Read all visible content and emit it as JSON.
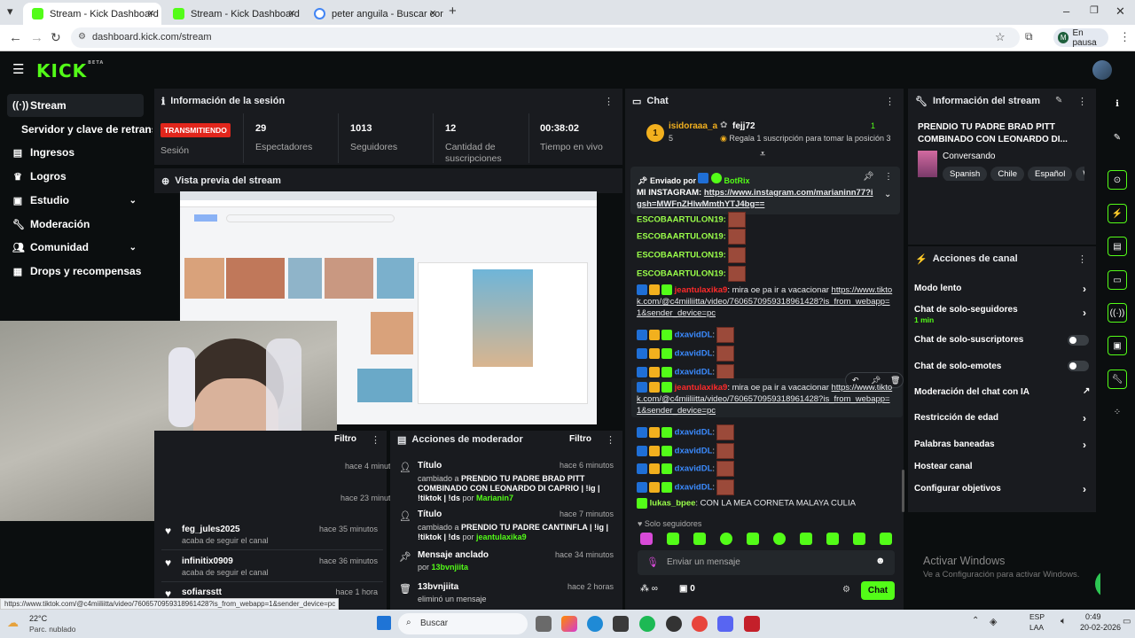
{
  "browser": {
    "tabs": [
      {
        "title": "Stream - Kick Dashboard",
        "fav": "#53fc18"
      },
      {
        "title": "Stream - Kick Dashboard",
        "fav": "#53fc18"
      },
      {
        "title": "peter anguila - Buscar con Goo",
        "fav": "#4285f4"
      }
    ],
    "url": "dashboard.kick.com/stream",
    "profile_initial": "M",
    "profile_status": "En pausa"
  },
  "kick": {
    "logo": "KICK",
    "beta": "BETA"
  },
  "sidebar": {
    "items": [
      {
        "label": "Stream",
        "icon": "((·))"
      },
      {
        "label": "Servidor y clave de retransmisión",
        "icon": ""
      },
      {
        "label": "Ingresos",
        "icon": "▤"
      },
      {
        "label": "Logros",
        "icon": "🏆"
      },
      {
        "label": "Estudio",
        "icon": "▣"
      },
      {
        "label": "Moderación",
        "icon": "🔧"
      },
      {
        "label": "Comunidad",
        "icon": "👥"
      },
      {
        "label": "Drops y recompensas",
        "icon": "🎁"
      }
    ]
  },
  "session": {
    "title": "Información de la sesión",
    "live_badge": "TRANSMITIENDO",
    "live_label": "Sesión",
    "stats": [
      {
        "value": "29",
        "label": "Espectadores"
      },
      {
        "value": "1013",
        "label": "Seguidores"
      },
      {
        "value": "12",
        "label": "Cantidad de suscripciones"
      },
      {
        "value": "00:38:02",
        "label": "Tiempo en vivo"
      }
    ]
  },
  "preview": {
    "title": "Vista previa del stream"
  },
  "chat": {
    "title": "Chat",
    "leaders": [
      {
        "name": "isidoraaa_a",
        "rank": "1",
        "count": "5"
      },
      {
        "name": "fejj72",
        "gift": "1",
        "text": "Regala 1 suscripción para tomar la posición 3"
      }
    ],
    "pinned": {
      "by_label": "Enviado por",
      "by": "BotRix",
      "text": "MI INSTAGRAM:",
      "link": "https://www.instagram.com/marianinn77?igsh=MWFnZHlwMmthYTJ4bg=="
    },
    "messages": [
      {
        "user": "ESCOBAARTULON19:",
        "color": "#9aff4a",
        "text": ""
      },
      {
        "user": "ESCOBAARTULON19:",
        "color": "#9aff4a",
        "text": ""
      },
      {
        "user": "ESCOBAARTULON19:",
        "color": "#9aff4a",
        "text": ""
      },
      {
        "user": "ESCOBAARTULON19:",
        "color": "#9aff4a",
        "text": ""
      },
      {
        "user": "jeantulaxika9",
        "color": "#ff2a2a",
        "text": ": mira oe pa ir a vacacionar",
        "link": "https://www.tiktok.com/@c4miiliitta/video/7606570959318961428?is_from_webapp=1&sender_device=pc"
      },
      {
        "user": "dxavidDL",
        "color": "#3b8bff",
        "text": ":"
      },
      {
        "user": "dxavidDL",
        "color": "#3b8bff",
        "text": ":"
      },
      {
        "user": "dxavidDL",
        "color": "#3b8bff",
        "text": ":"
      },
      {
        "user": "jeantulaxika9",
        "color": "#ff2a2a",
        "text": ": mira oe pa ir a vacacionar",
        "link": "https://www.tiktok.com/@c4miiliitta/video/7606570959318961428?is_from_webapp=1&sender_device=pc"
      },
      {
        "user": "dxavidDL",
        "color": "#3b8bff",
        "text": ":"
      },
      {
        "user": "dxavidDL",
        "color": "#3b8bff",
        "text": ":"
      },
      {
        "user": "dxavidDL",
        "color": "#3b8bff",
        "text": ":"
      },
      {
        "user": "dxavidDL",
        "color": "#3b8bff",
        "text": ":"
      },
      {
        "user": "lukas_bpee",
        "color": "#9aff4a",
        "text": ": CON LA MEA CORNETA MALAYA CULIA"
      }
    ],
    "mode": "Solo seguidores",
    "input_placeholder": "Enviar un mensaje",
    "points": "∞",
    "gifts": "0",
    "send": "Chat"
  },
  "stream_info": {
    "title": "Información del stream",
    "stream_title": "PRENDIO TU PADRE BRAD PITT COMBINADO CON LEONARDO DI...",
    "category": "Conversando",
    "tags": [
      "Spanish",
      "Chile",
      "Español",
      "Wa"
    ]
  },
  "channel_actions": {
    "title": "Acciones de canal",
    "items": [
      {
        "label": "Modo lento"
      },
      {
        "label": "Chat de solo-seguidores",
        "sub": "1 min"
      },
      {
        "label": "Chat de solo-suscriptores"
      },
      {
        "label": "Chat de solo-emotes"
      },
      {
        "label": "Moderación del chat con IA"
      },
      {
        "label": "Restricción de edad"
      },
      {
        "label": "Palabras baneadas"
      },
      {
        "label": "Hostear canal"
      },
      {
        "label": "Configurar objetivos"
      }
    ]
  },
  "mod": {
    "title": "Acciones de moderador",
    "filter": "Filtro",
    "items": [
      {
        "type": "Título",
        "time": "hace 6 minutos",
        "pre": "cambiado a ",
        "bold": "PRENDIO TU PADRE BRAD PITT COMBINADO CON LEONARDO DI CAPRIO | !ig | !tiktok | !ds",
        "mid": " por ",
        "user": "Marianin7"
      },
      {
        "type": "Título",
        "time": "hace 7 minutos",
        "pre": "cambiado a ",
        "bold": "PRENDIO TU PADRE CANTINFLA | !ig | !tiktok | !ds",
        "mid": " por ",
        "user": "jeantulaxika9"
      },
      {
        "type": "Mensaje anclado",
        "time": "hace 34 minutos",
        "pre": "",
        "bold": "",
        "mid": "por ",
        "user": "13bvnjiita"
      },
      {
        "type": "13bvnjiita",
        "time": "hace 2 horas",
        "pre": "eliminó un mensaje",
        "bold": "",
        "mid": "",
        "user": ""
      }
    ]
  },
  "activity": {
    "filter": "Filtro",
    "times_top": [
      "hace 4 minutos",
      "hace 23 minutos"
    ],
    "items": [
      {
        "user": "feg_jules2025",
        "sub": "acaba de seguir el canal",
        "time": "hace 35 minutos"
      },
      {
        "user": "infinitix0909",
        "sub": "acaba de seguir el canal",
        "time": "hace 36 minutos"
      },
      {
        "user": "sofiarsstt",
        "sub": "",
        "time": "hace 1 hora"
      }
    ]
  },
  "status_url": "https://www.tiktok.com/@c4miiliitta/video/7606570959318961428?is_from_webapp=1&sender_device=pc",
  "watermark": {
    "title": "Activar Windows",
    "sub": "Ve a Configuración para activar Windows."
  },
  "taskbar": {
    "temp": "22°C",
    "weather": "Parc. nublado",
    "search": "Buscar",
    "lang": "ESP",
    "lang2": "LAA",
    "time": "0:49",
    "date": "20-02-2026"
  }
}
